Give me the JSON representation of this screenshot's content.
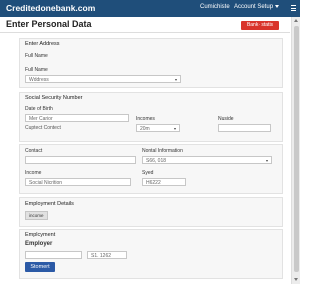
{
  "topbar": {
    "brand": "Creditedonebank.com",
    "nav": [
      "Cumichiste",
      "Account Setup"
    ]
  },
  "header": {
    "title": "Enter Personal Data",
    "action_label": "Bank· statis"
  },
  "sections": {
    "address": "Enter Address",
    "ssn": "Social Security Number",
    "employment_details": "Employment Details",
    "employment": "Emplcyment"
  },
  "labels": {
    "name": "Full Name",
    "full_name": "Full Name",
    "dob": "Date of Birth",
    "incomes": "Incomes",
    "nuside": "Nuside",
    "contact": "Contact",
    "nontal_information": "Nontal Information",
    "income": "Income",
    "syed": "Syed",
    "employer": "Employer"
  },
  "fields": {
    "full_name_value": "Wddress",
    "dob_value": "Mer Carior",
    "dob_hint": "Cuptect Contect",
    "incomes_value": "20m",
    "nuside_value": "",
    "contact_value": "",
    "nontal_value": "S66, 018",
    "income_value": "Social Nicrition",
    "syed_value": "H6222",
    "employer_value": "",
    "employer_amount": "S1. 1262"
  },
  "chips": {
    "employment_details": "income"
  },
  "submit_label": "Stomert"
}
